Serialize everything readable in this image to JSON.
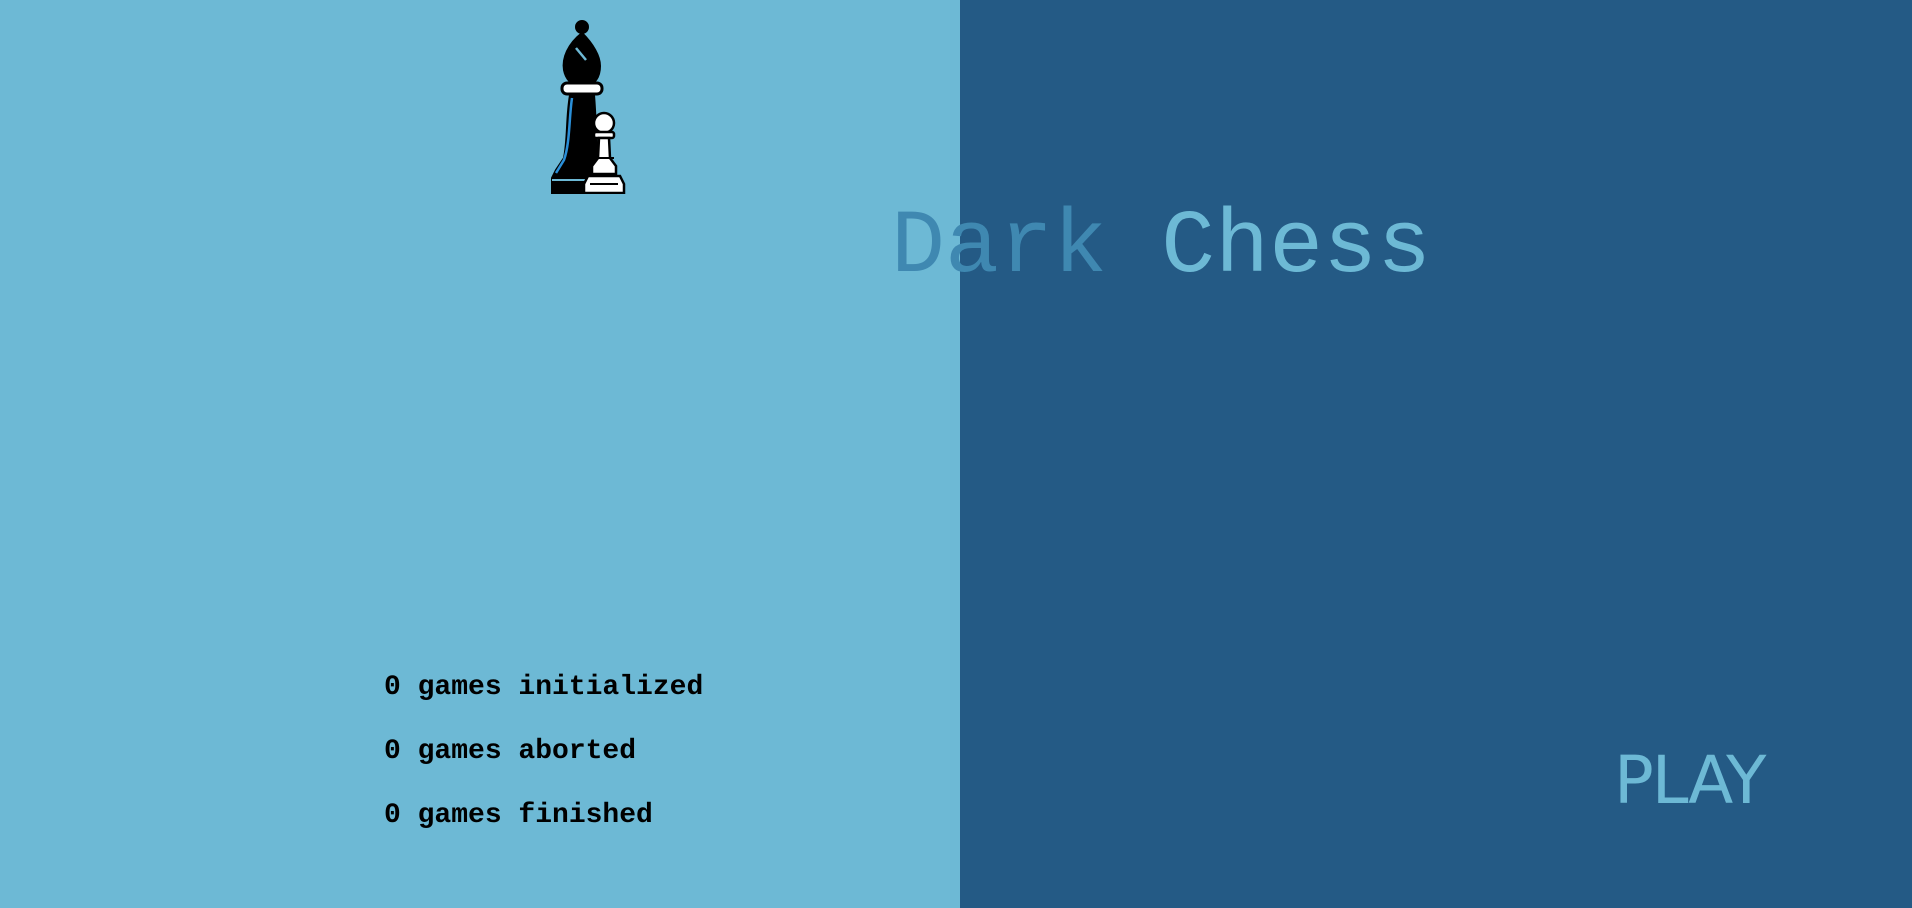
{
  "colors": {
    "light_blue": "#6db9d5",
    "dark_blue": "#245a85",
    "title_dark_part": "#3f88b1",
    "title_light_part": "#6db9d5",
    "play_text": "#6db9d5"
  },
  "logo": {
    "icon": "bishop-and-pawn-icon"
  },
  "title": {
    "part1": "Dark ",
    "part2": "Chess"
  },
  "stats": [
    "0 games initialized",
    "0 games aborted",
    "0 games finished"
  ],
  "play_button": {
    "label": "PLAY"
  }
}
